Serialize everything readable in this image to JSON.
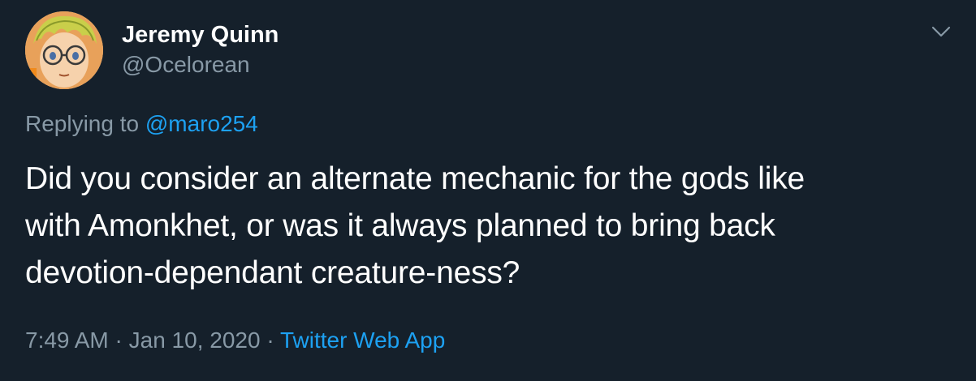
{
  "author": {
    "name": "Jeremy Quinn",
    "handle": "@Ocelorean",
    "avatar_icon": "anime-avatar-with-glasses"
  },
  "menu_icon": "chevron-down-icon",
  "reply": {
    "prefix": "Replying to",
    "mention": "@maro254"
  },
  "tweet": {
    "lines": [
      "Did you consider an alternate mechanic for the gods like",
      "with Amonkhet, or was it always planned to bring back",
      "devotion-dependant creature-ness?"
    ]
  },
  "meta": {
    "time": "7:49 AM",
    "separator": "·",
    "date": "Jan 10, 2020",
    "source": "Twitter Web App"
  },
  "colors": {
    "background": "#15202b",
    "text": "#ffffff",
    "secondary": "#8899a6",
    "link": "#1da1f2"
  }
}
